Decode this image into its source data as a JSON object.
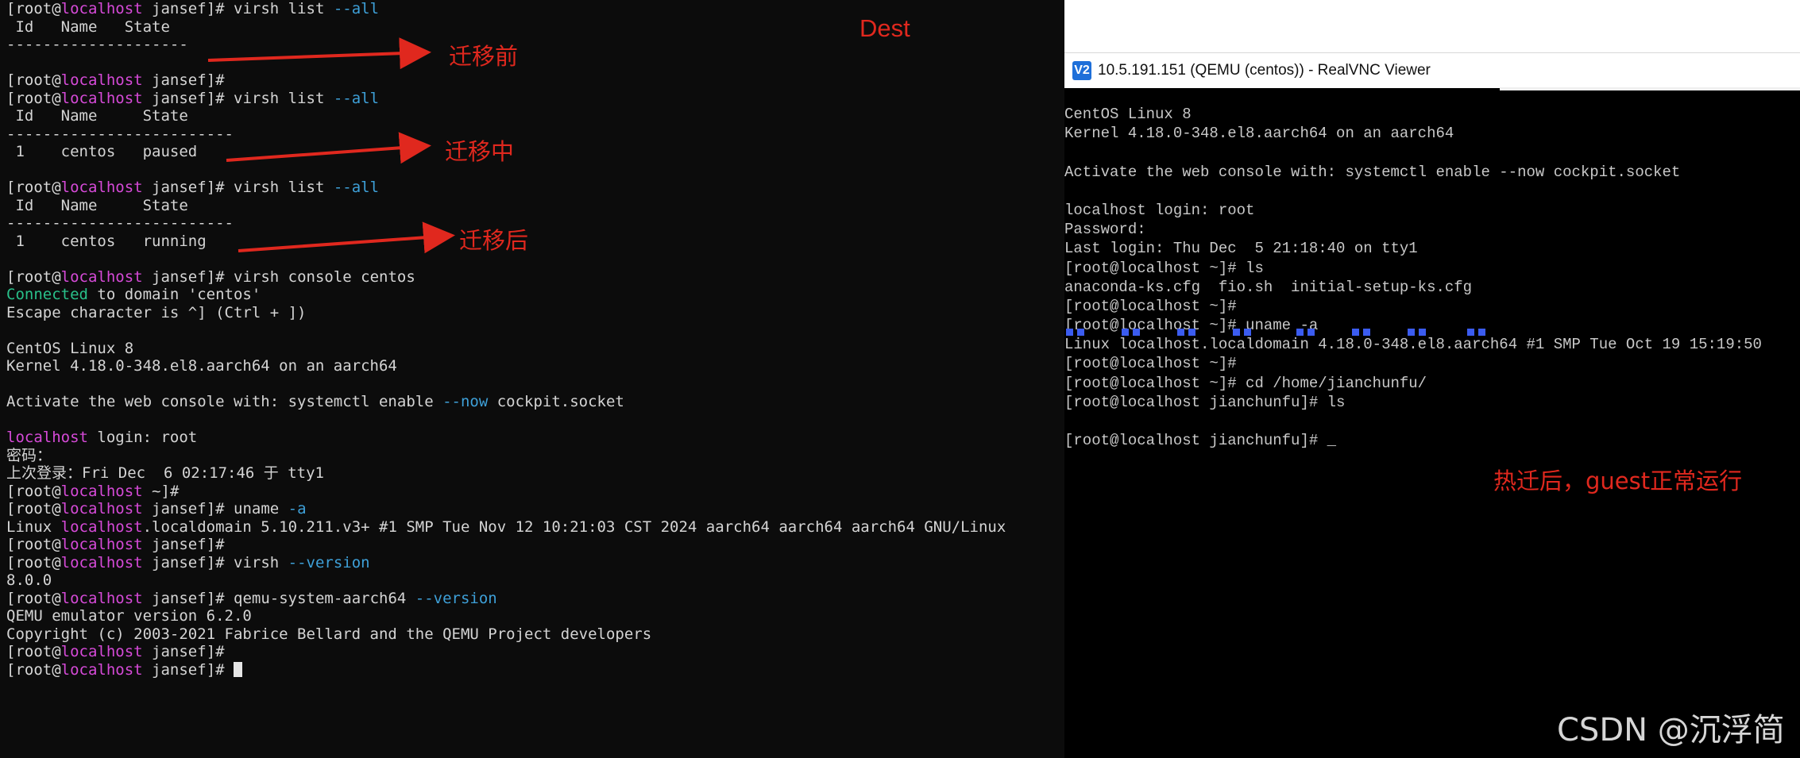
{
  "left_terminal": {
    "prompt_open": "[root@",
    "host": "localhost",
    "dir": "jansef",
    "prompt_close": "]#",
    "lines": [
      {
        "kind": "prompt",
        "cmd": " virsh list ",
        "opt": "--all"
      },
      {
        "kind": "text",
        "text": " Id   Name   State"
      },
      {
        "kind": "text",
        "text": "--------------------"
      },
      {
        "kind": "blank"
      },
      {
        "kind": "prompt",
        "cmd": ""
      },
      {
        "kind": "prompt",
        "cmd": " virsh list ",
        "opt": "--all"
      },
      {
        "kind": "text",
        "text": " Id   Name     State"
      },
      {
        "kind": "text",
        "text": "-------------------------"
      },
      {
        "kind": "text",
        "text": " 1    centos   paused"
      },
      {
        "kind": "blank"
      },
      {
        "kind": "prompt",
        "cmd": " virsh list ",
        "opt": "--all"
      },
      {
        "kind": "text",
        "text": " Id   Name     State"
      },
      {
        "kind": "text",
        "text": "-------------------------"
      },
      {
        "kind": "text",
        "text": " 1    centos   running"
      },
      {
        "kind": "blank"
      },
      {
        "kind": "prompt",
        "cmd": " virsh console centos"
      },
      {
        "kind": "connected",
        "green": "Connected",
        "rest": " to domain 'centos'"
      },
      {
        "kind": "text",
        "text": "Escape character is ^] (Ctrl + ])"
      },
      {
        "kind": "blank"
      },
      {
        "kind": "text",
        "text": "CentOS Linux 8"
      },
      {
        "kind": "text",
        "text": "Kernel 4.18.0-348.el8.aarch64 on an aarch64"
      },
      {
        "kind": "blank"
      },
      {
        "kind": "mixed",
        "pre": "Activate the web console with: systemctl enable ",
        "opt": "--now",
        "post": " cockpit.socket"
      },
      {
        "kind": "blank"
      },
      {
        "kind": "login",
        "host": "localhost",
        "rest": " login: root"
      },
      {
        "kind": "text",
        "text": "密码："
      },
      {
        "kind": "text",
        "text": "上次登录：Fri Dec  6 02:17:46 于 tty1"
      },
      {
        "kind": "prompt",
        "dir_override": "~",
        "cmd": ""
      },
      {
        "kind": "prompt",
        "cmd": " uname ",
        "opt": "-a"
      },
      {
        "kind": "linux",
        "pre": "Linux ",
        "host": "localhost",
        "rest": ".localdomain 5.10.211.v3+ #1 SMP Tue Nov 12 10:21:03 CST 2024 aarch64 aarch64 aarch64 GNU/Linux"
      },
      {
        "kind": "prompt",
        "cmd": ""
      },
      {
        "kind": "prompt",
        "cmd": " virsh ",
        "opt": "--version"
      },
      {
        "kind": "text",
        "text": "8.0.0"
      },
      {
        "kind": "prompt",
        "cmd": " qemu-system-aarch64 ",
        "opt": "--version"
      },
      {
        "kind": "text",
        "text": "QEMU emulator version 6.2.0"
      },
      {
        "kind": "text",
        "text": "Copyright (c) 2003-2021 Fabrice Bellard and the QEMU Project developers"
      },
      {
        "kind": "prompt",
        "cmd": ""
      },
      {
        "kind": "prompt",
        "cmd": " ",
        "cursor": true
      }
    ]
  },
  "annotations": {
    "dest": "Dest",
    "before": "迁移前",
    "during": "迁移中",
    "after": "迁移后",
    "guest_ok": "热迁后，guest正常运行"
  },
  "vnc": {
    "title": "10.5.191.151 (QEMU (centos)) - RealVNC Viewer",
    "icon": "V2",
    "lines": [
      "CentOS Linux 8",
      "Kernel 4.18.0-348.el8.aarch64 on an aarch64",
      "",
      "Activate the web console with: systemctl enable --now cockpit.socket",
      "",
      "localhost login: root",
      "Password:",
      "Last login: Thu Dec  5 21:18:40 on tty1",
      "[root@localhost ~]# ls",
      "anaconda-ks.cfg  fio.sh  initial-setup-ks.cfg",
      "[root@localhost ~]#",
      "[root@localhost ~]# uname -a",
      "Linux localhost.localdomain 4.18.0-348.el8.aarch64 #1 SMP Tue Oct 19 15:19:50",
      "[root@localhost ~]#",
      "[root@localhost ~]# cd /home/jianchunfu/",
      "[root@localhost jianchunfu]# ls",
      "",
      "[root@localhost jianchunfu]# _"
    ],
    "dot_color": "#3b5cf0"
  },
  "watermark": "CSDN @沉浮简"
}
